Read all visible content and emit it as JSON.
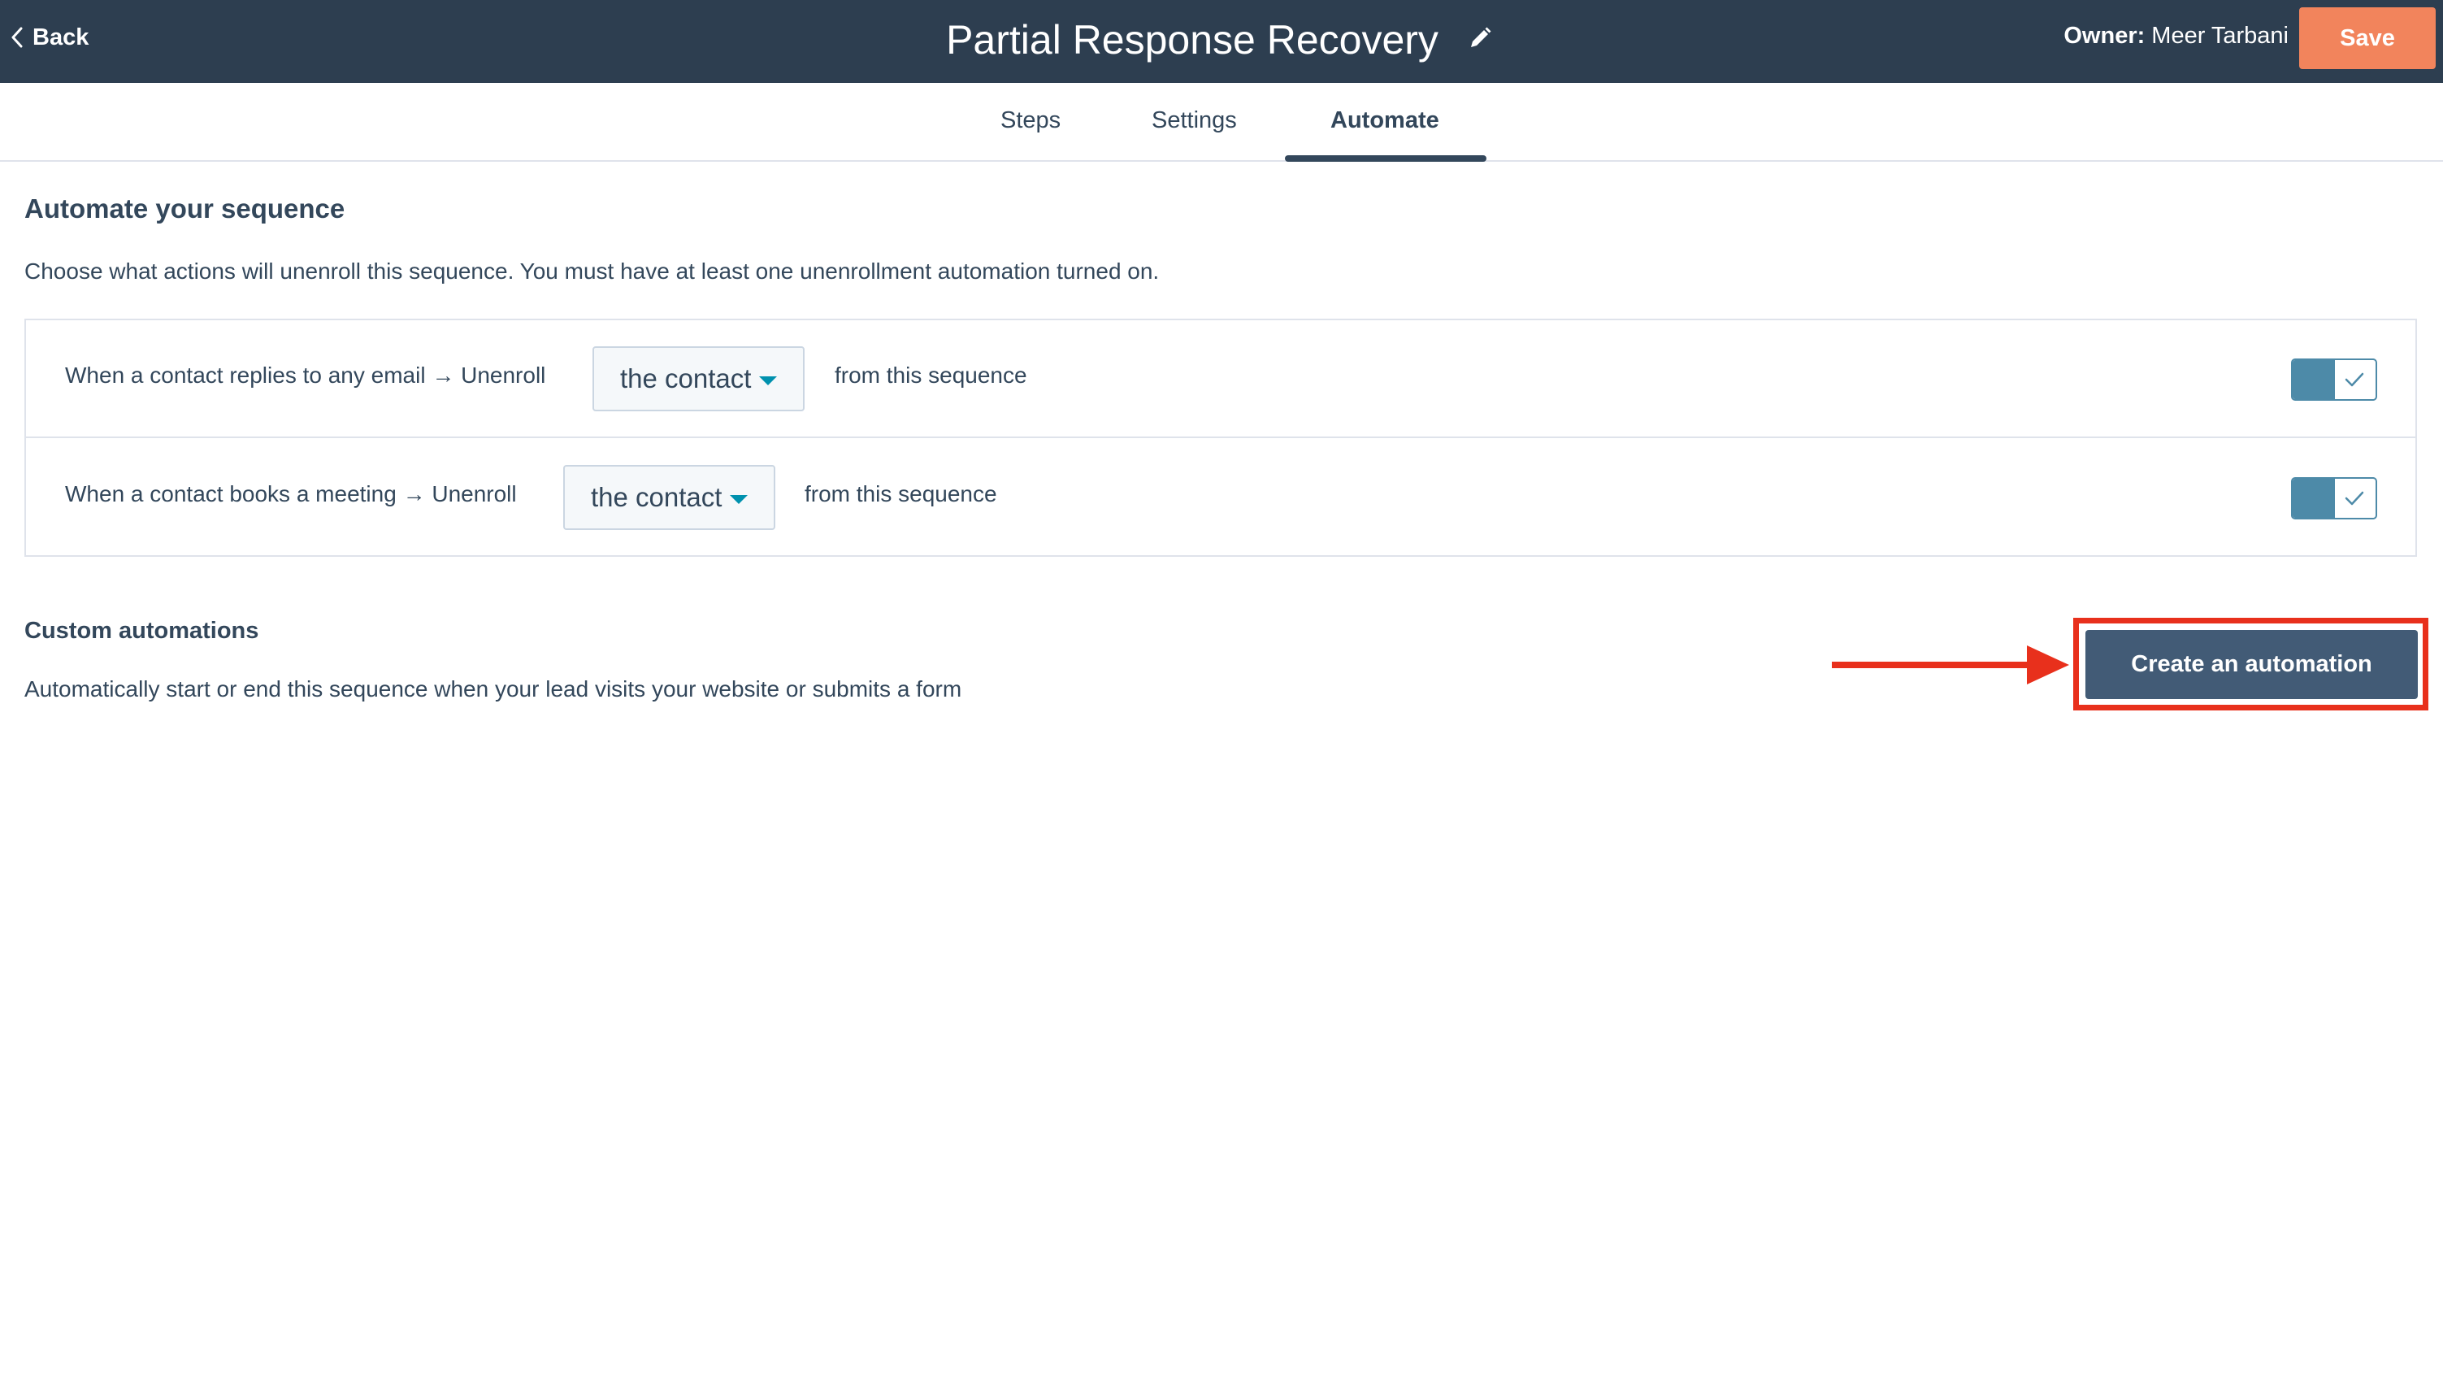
{
  "header": {
    "back_label": "Back",
    "title": "Partial Response Recovery",
    "owner_label": "Owner:",
    "owner_name": "Meer Tarbani",
    "save_label": "Save"
  },
  "tabs": [
    {
      "label": "Steps",
      "active": false
    },
    {
      "label": "Settings",
      "active": false
    },
    {
      "label": "Automate",
      "active": true
    }
  ],
  "automate": {
    "title": "Automate your sequence",
    "description": "Choose what actions will unenroll this sequence. You must have at least one unenrollment automation turned on.",
    "rules": [
      {
        "prefix": "When a contact replies to any email → Unenroll",
        "dropdown_value": "the contact",
        "suffix": "from this sequence",
        "enabled": true
      },
      {
        "prefix": "When a contact books a meeting → Unenroll",
        "dropdown_value": "the contact",
        "suffix": "from this sequence",
        "enabled": true
      }
    ]
  },
  "custom": {
    "title": "Custom automations",
    "description": "Automatically start or end this sequence when your lead visits your website or submits a form",
    "create_button_label": "Create an automation"
  },
  "colors": {
    "header_bg": "#2d3e50",
    "save_button": "#f2845c",
    "toggle_on": "#4d8aa8",
    "primary_button": "#425b76",
    "annotation": "#e8301c",
    "text": "#33475b"
  }
}
